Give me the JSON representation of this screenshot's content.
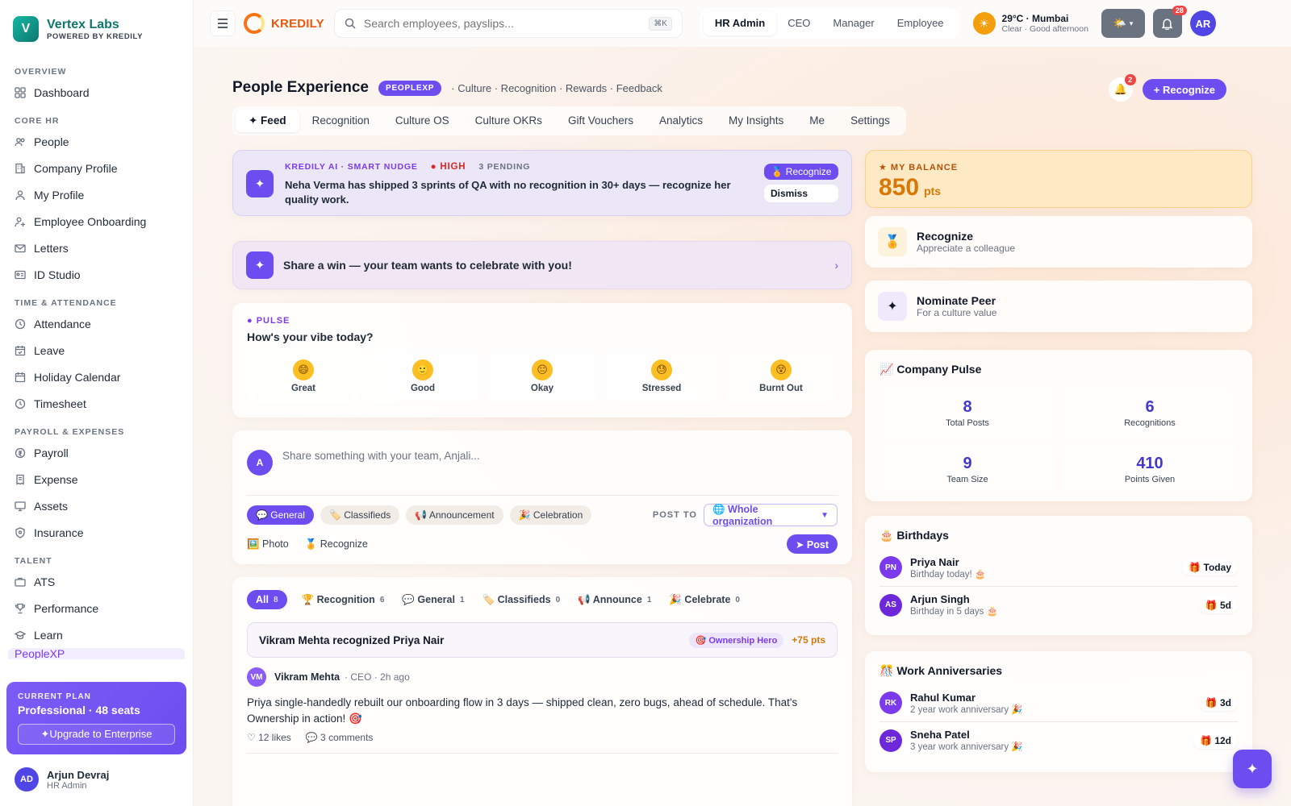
{
  "brand": {
    "initial": "V",
    "name": "Vertex Labs",
    "powered": "POWERED BY KREDILY"
  },
  "sidebar": {
    "sections": [
      {
        "title": "OVERVIEW",
        "items": [
          {
            "label": "Dashboard",
            "icon": "grid-icon"
          }
        ]
      },
      {
        "title": "CORE HR",
        "items": [
          {
            "label": "People",
            "icon": "users-icon"
          },
          {
            "label": "Company Profile",
            "icon": "building-icon"
          },
          {
            "label": "My Profile",
            "icon": "user-icon"
          },
          {
            "label": "Employee Onboarding",
            "icon": "user-plus-icon"
          },
          {
            "label": "Letters",
            "icon": "mail-icon"
          },
          {
            "label": "ID Studio",
            "icon": "id-card-icon"
          }
        ]
      },
      {
        "title": "TIME & ATTENDANCE",
        "items": [
          {
            "label": "Attendance",
            "icon": "clock-icon"
          },
          {
            "label": "Leave",
            "icon": "calendar-check-icon"
          },
          {
            "label": "Holiday Calendar",
            "icon": "calendar-icon"
          },
          {
            "label": "Timesheet",
            "icon": "clock-icon"
          }
        ]
      },
      {
        "title": "PAYROLL & EXPENSES",
        "items": [
          {
            "label": "Payroll",
            "icon": "coin-icon"
          },
          {
            "label": "Expense",
            "icon": "receipt-icon"
          },
          {
            "label": "Assets",
            "icon": "monitor-icon"
          },
          {
            "label": "Insurance",
            "icon": "shield-icon"
          }
        ]
      },
      {
        "title": "TALENT",
        "items": [
          {
            "label": "ATS",
            "icon": "briefcase-icon"
          },
          {
            "label": "Performance",
            "icon": "trophy-icon"
          },
          {
            "label": "Learn",
            "icon": "graduation-cap-icon"
          }
        ]
      }
    ],
    "partial_item": "PeopleXP",
    "plan": {
      "label": "CURRENT PLAN",
      "name": "Professional · 48 seats",
      "upgrade": "✦Upgrade to Enterprise"
    },
    "user": {
      "initials": "AD",
      "name": "Arjun Devraj",
      "role": "HR Admin"
    }
  },
  "topbar": {
    "product": "KREDILY",
    "search_placeholder": "Search employees, payslips...",
    "shortcut": "⌘K",
    "roles": [
      "HR Admin",
      "CEO",
      "Manager",
      "Employee"
    ],
    "active_role": "HR Admin",
    "weather": {
      "temp": "29°C · Mumbai",
      "sub": "Clear · Good afternoon"
    },
    "notif_count": "28",
    "avatar": "AR"
  },
  "page": {
    "title": "People Experience",
    "badge": "PEOPLEXP",
    "tags": "· Culture · Recognition · Rewards · Feedback",
    "bell_count": "2",
    "recognize_btn": "+ Recognize",
    "tabs": [
      "✦ Feed",
      "Recognition",
      "Culture OS",
      "Culture OKRs",
      "Gift Vouchers",
      "Analytics",
      "My Insights",
      "Me",
      "Settings"
    ]
  },
  "nudge": {
    "source": "KREDILY AI · SMART NUDGE",
    "priority": "● HIGH",
    "pending": "3 PENDING",
    "text": "Neha Verma has shipped 3 sprints of QA with no recognition in 30+ days — recognize her quality work.",
    "recognize": "🏅 Recognize",
    "dismiss": "Dismiss"
  },
  "share_win": {
    "text": "Share a win — your team wants to celebrate with you!"
  },
  "pulse": {
    "label": "● PULSE",
    "question": "How's your vibe today?",
    "moods": [
      {
        "label": "Great",
        "emoji": "😄"
      },
      {
        "label": "Good",
        "emoji": "🙂"
      },
      {
        "label": "Okay",
        "emoji": "😐"
      },
      {
        "label": "Stressed",
        "emoji": "😓"
      },
      {
        "label": "Burnt Out",
        "emoji": "😵"
      }
    ]
  },
  "composer": {
    "initial": "A",
    "placeholder": "Share something with your team, Anjali...",
    "chips": [
      "💬 General",
      "🏷️ Classifieds",
      "📢 Announcement",
      "🎉 Celebration"
    ],
    "post_to_label": "POST TO",
    "post_to_value": "🌐 Whole organization",
    "photo": "🖼️ Photo",
    "recognize": "🏅 Recognize",
    "post_btn": "➤ Post"
  },
  "feed": {
    "filters": [
      {
        "label": "All",
        "count": "8"
      },
      {
        "label": "🏆 Recognition",
        "count": "6"
      },
      {
        "label": "💬 General",
        "count": "1"
      },
      {
        "label": "🏷️ Classifieds",
        "count": "0"
      },
      {
        "label": "📢 Announce",
        "count": "1"
      },
      {
        "label": "🎉 Celebrate",
        "count": "0"
      }
    ],
    "post": {
      "title": "Vikram Mehta recognized Priya Nair",
      "value_badge": "🎯 Ownership Hero",
      "points": "+75 pts",
      "author_initials": "VM",
      "author": "Vikram Mehta",
      "meta": "· CEO · 2h ago",
      "body": "Priya single-handedly rebuilt our onboarding flow in 3 days — shipped clean, zero bugs, ahead of schedule. That's Ownership in action! 🎯",
      "likes": "♡ 12 likes",
      "comments": "💬 3 comments"
    }
  },
  "balance": {
    "label": "★ MY BALANCE",
    "value": "850",
    "unit": "pts"
  },
  "actions": [
    {
      "title": "Recognize",
      "sub": "Appreciate a colleague",
      "icon": "🏅"
    },
    {
      "title": "Nominate Peer",
      "sub": "For a culture value",
      "icon": "✦"
    }
  ],
  "company_pulse": {
    "title": "📈 Company Pulse",
    "stats": [
      {
        "value": "8",
        "label": "Total Posts"
      },
      {
        "value": "6",
        "label": "Recognitions"
      },
      {
        "value": "9",
        "label": "Team Size"
      },
      {
        "value": "410",
        "label": "Points Given"
      }
    ]
  },
  "birthdays": {
    "title": "🎂 Birthdays",
    "items": [
      {
        "initials": "PN",
        "name": "Priya Nair",
        "sub": "Birthday today! 🎂",
        "tag": "🎁 Today"
      },
      {
        "initials": "AS",
        "name": "Arjun Singh",
        "sub": "Birthday in 5 days 🎂",
        "tag": "🎁 5d"
      }
    ]
  },
  "anniversaries": {
    "title": "🎊 Work Anniversaries",
    "items": [
      {
        "initials": "RK",
        "name": "Rahul Kumar",
        "sub": "2 year work anniversary 🎉",
        "tag": "🎁 3d"
      },
      {
        "initials": "SP",
        "name": "Sneha Patel",
        "sub": "3 year work anniversary 🎉",
        "tag": "🎁 12d"
      }
    ]
  },
  "colors": {
    "accent": "#6d4df0",
    "brand_teal": "#0f766e",
    "kredily_orange": "#ea580c",
    "points_amber": "#d97706"
  }
}
